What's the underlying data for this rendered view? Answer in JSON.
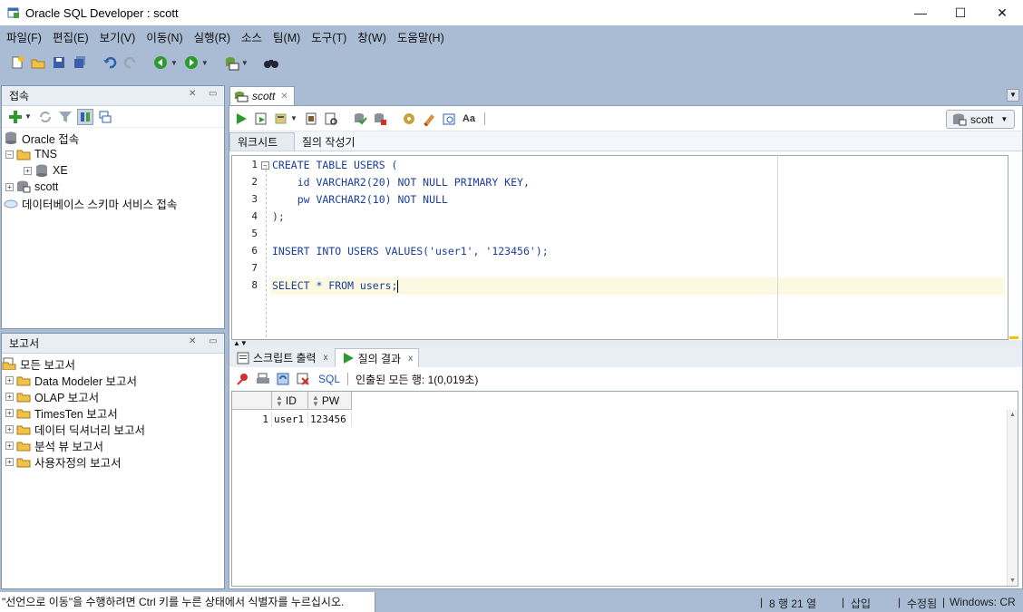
{
  "window": {
    "title": "Oracle SQL Developer : scott",
    "minimize": "—",
    "maximize": "☐",
    "close": "✕"
  },
  "menu": [
    "파일(F)",
    "편집(E)",
    "보기(V)",
    "이동(N)",
    "실행(R)",
    "소스",
    "팀(M)",
    "도구(T)",
    "창(W)",
    "도움말(H)"
  ],
  "connections_panel": {
    "title": "접속",
    "tree": {
      "root": "Oracle 접속",
      "tns": "TNS",
      "xe": "XE",
      "scott": "scott",
      "cloud": "데이터베이스 스키마 서비스 접속"
    }
  },
  "reports_panel": {
    "title": "보고서",
    "root": "모든 보고서",
    "items": [
      "Data Modeler 보고서",
      "OLAP 보고서",
      "TimesTen 보고서",
      "데이터 딕셔너리 보고서",
      "분석 뷰 보고서",
      "사용자정의 보고서"
    ]
  },
  "editor": {
    "tab": "scott",
    "connection": "scott",
    "subtabs": [
      "워크시트",
      "질의 작성기"
    ],
    "line_numbers": [
      "1",
      "2",
      "3",
      "4",
      "5",
      "6",
      "7",
      "8"
    ],
    "lines": [
      "CREATE TABLE USERS (",
      "    id VARCHAR2(20) NOT NULL PRIMARY KEY,",
      "    pw VARCHAR2(10) NOT NULL",
      ");",
      "",
      "INSERT INTO USERS VALUES('user1', '123456');",
      "",
      "SELECT * FROM users;"
    ]
  },
  "results": {
    "tabs": [
      "스크립트 출력",
      "질의 결과"
    ],
    "sql_link": "SQL",
    "fetch_msg": "인출된 모든 행: 1(0,019초)",
    "columns": [
      "ID",
      "PW"
    ],
    "rows": [
      {
        "num": "1",
        "id": "user1",
        "pw": "123456"
      }
    ]
  },
  "status": {
    "message": "\"선언으로 이동\"을 수행하려면 Ctrl 키를 누른 상태에서 식별자를 누르십시오.",
    "position": "8 행 21 열",
    "insert_mode": "삽입",
    "modified": "수정됨",
    "line_ending": "Windows: CR"
  },
  "colors": {
    "chrome": "#a9bcd4",
    "keyword": "#1a3d9c",
    "current_line": "#fbf9e2"
  }
}
